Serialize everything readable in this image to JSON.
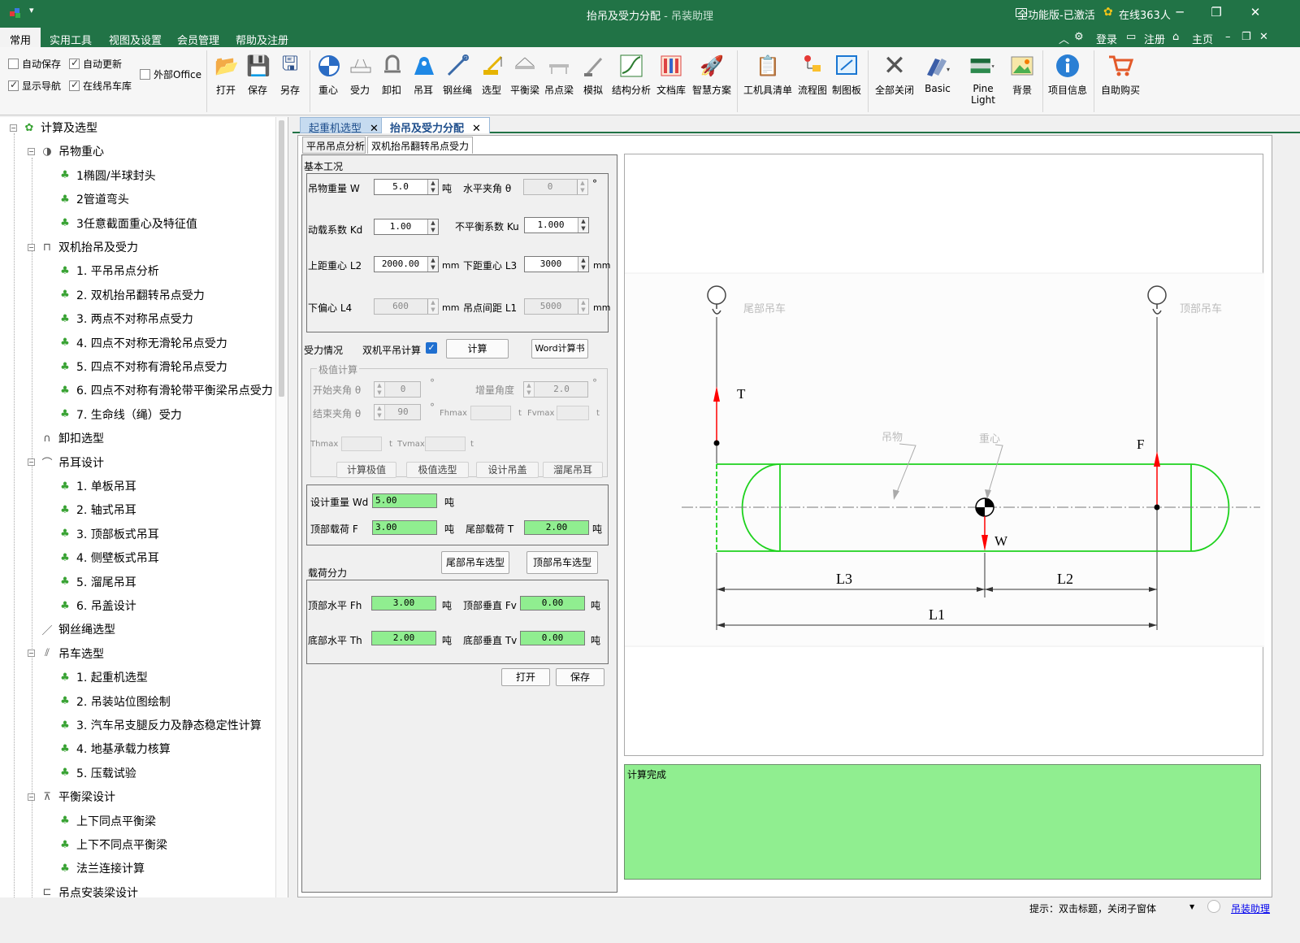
{
  "window": {
    "title": "抬吊及受力分配",
    "title_suffix": " - 吊装助理",
    "edition": "全功能版-已激活",
    "online": "在线363人"
  },
  "menu": {
    "items": [
      "常用",
      "实用工具",
      "视图及设置",
      "会员管理",
      "帮助及注册"
    ],
    "active": "常用",
    "login": "登录",
    "register": "注册",
    "home": "主页"
  },
  "ribbon": {
    "checks": [
      {
        "label": "自动保存",
        "checked": false
      },
      {
        "label": "自动更新",
        "checked": true
      },
      {
        "label": "外部Office",
        "checked": false
      },
      {
        "label": "显示导航",
        "checked": true
      },
      {
        "label": "在线吊车库",
        "checked": true
      }
    ],
    "buttons": [
      {
        "label": "打开",
        "icon": "folder-icon"
      },
      {
        "label": "保存",
        "icon": "save-icon"
      },
      {
        "label": "另存",
        "icon": "save-as-icon"
      },
      {
        "label": "重心",
        "icon": "center-gravity-icon"
      },
      {
        "label": "受力",
        "icon": "force-icon"
      },
      {
        "label": "卸扣",
        "icon": "shackle-icon"
      },
      {
        "label": "吊耳",
        "icon": "lug-icon"
      },
      {
        "label": "钢丝绳",
        "icon": "wire-rope-icon"
      },
      {
        "label": "选型",
        "icon": "crane-icon"
      },
      {
        "label": "平衡梁",
        "icon": "balance-beam-icon"
      },
      {
        "label": "吊点梁",
        "icon": "lift-beam-icon"
      },
      {
        "label": "模拟",
        "icon": "simulate-icon"
      },
      {
        "label": "结构分析",
        "icon": "analysis-icon"
      },
      {
        "label": "文档库",
        "icon": "library-icon"
      },
      {
        "label": "智慧方案",
        "icon": "smart-icon"
      },
      {
        "label": "工机具清单",
        "icon": "clipboard-icon"
      },
      {
        "label": "流程图",
        "icon": "flowchart-icon"
      },
      {
        "label": "制图板",
        "icon": "drawing-board-icon"
      },
      {
        "label": "全部关闭",
        "icon": "close-all-icon"
      },
      {
        "label": "Basic",
        "icon": "theme-basic-icon"
      },
      {
        "label": "Pine Light",
        "icon": "theme-pine-icon"
      },
      {
        "label": "背景",
        "icon": "background-icon"
      },
      {
        "label": "项目信息",
        "icon": "info-icon"
      },
      {
        "label": "自助购买",
        "icon": "cart-icon"
      }
    ]
  },
  "tree": [
    {
      "label": "计算及选型",
      "level": 0,
      "expander": "⊟"
    },
    {
      "label": "吊物重心",
      "level": 1,
      "expander": "⊟"
    },
    {
      "label": "1椭圆/半球封头",
      "level": 2
    },
    {
      "label": "2管道弯头",
      "level": 2
    },
    {
      "label": "3任意截面重心及特征值",
      "level": 2
    },
    {
      "label": "双机抬吊及受力",
      "level": 1,
      "expander": "⊟"
    },
    {
      "label": "1. 平吊吊点分析",
      "level": 2
    },
    {
      "label": "2. 双机抬吊翻转吊点受力",
      "level": 2
    },
    {
      "label": "3. 两点不对称吊点受力",
      "level": 2
    },
    {
      "label": "4. 四点不对称无滑轮吊点受力",
      "level": 2
    },
    {
      "label": "5. 四点不对称有滑轮吊点受力",
      "level": 2
    },
    {
      "label": "6. 四点不对称有滑轮带平衡梁吊点受力",
      "level": 2
    },
    {
      "label": "7. 生命线（绳）受力",
      "level": 2
    },
    {
      "label": "卸扣选型",
      "level": 1
    },
    {
      "label": "吊耳设计",
      "level": 1,
      "expander": "⊟"
    },
    {
      "label": "1. 单板吊耳",
      "level": 2
    },
    {
      "label": "2. 轴式吊耳",
      "level": 2
    },
    {
      "label": "3. 顶部板式吊耳",
      "level": 2
    },
    {
      "label": "4. 侧壁板式吊耳",
      "level": 2
    },
    {
      "label": "5. 溜尾吊耳",
      "level": 2
    },
    {
      "label": "6. 吊盖设计",
      "level": 2
    },
    {
      "label": "钢丝绳选型",
      "level": 1
    },
    {
      "label": "吊车选型",
      "level": 1,
      "expander": "⊟"
    },
    {
      "label": "1. 起重机选型",
      "level": 2
    },
    {
      "label": "2. 吊装站位图绘制",
      "level": 2
    },
    {
      "label": "3. 汽车吊支腿反力及静态稳定性计算",
      "level": 2
    },
    {
      "label": "4. 地基承载力核算",
      "level": 2
    },
    {
      "label": "5. 压载试验",
      "level": 2
    },
    {
      "label": "平衡梁设计",
      "level": 1,
      "expander": "⊟"
    },
    {
      "label": "上下同点平衡梁",
      "level": 2
    },
    {
      "label": "上下不同点平衡梁",
      "level": 2
    },
    {
      "label": "法兰连接计算",
      "level": 2
    },
    {
      "label": "吊点安装梁设计",
      "level": 1
    }
  ],
  "doc_tabs": [
    {
      "label": "起重机选型",
      "active": false
    },
    {
      "label": "抬吊及受力分配",
      "active": true
    }
  ],
  "sub_tabs": [
    {
      "label": "平吊吊点分析",
      "active": false
    },
    {
      "label": "双机抬吊翻转吊点受力",
      "active": true
    }
  ],
  "form": {
    "basic_title": "基本工况",
    "weight_label": "吊物重量 W",
    "weight": "5.0",
    "ton": "吨",
    "angle_label": "水平夹角 θ",
    "angle": "0",
    "deg": "°",
    "kd_label": "动载系数 Kd",
    "kd": "1.00",
    "ku_label": "不平衡系数 Ku",
    "ku": "1.000",
    "l2_label": "上距重心 L2",
    "l2": "2000.00",
    "mm": "mm",
    "l3_label": "下距重心 L3",
    "l3": "3000",
    "l4_label": "下偏心 L4",
    "l4": "600",
    "l1_label": "吊点间距 L1",
    "l1": "5000",
    "force_title": "受力情况",
    "dual_label": "双机平吊计算",
    "dual_checked": true,
    "calc_btn": "计算",
    "word_btn": "Word计算书",
    "extreme_title": "极值计算",
    "start_angle_label": "开始夹角 θ",
    "start_angle": "0",
    "step_label": "增量角度",
    "step": "2.0",
    "end_angle_label": "结束夹角 θ",
    "end_angle": "90",
    "fhmax_label": "Fhmax",
    "fvmax_label": "Fvmax",
    "t_unit": "t",
    "thmax_label": "Thmax",
    "tvmax_label": "Tvmax",
    "btn_calc_extreme": "计算极值",
    "btn_extreme_select": "极值选型",
    "btn_design_cover": "设计吊盖",
    "btn_tail_lug": "溜尾吊耳",
    "design_weight_label": "设计重量 Wd",
    "design_weight": "5.00",
    "top_load_label": "顶部载荷 F",
    "top_load": "3.00",
    "tail_load_label": "尾部载荷 T",
    "tail_load": "2.00",
    "tail_crane_btn": "尾部吊车选型",
    "top_crane_btn": "顶部吊车选型",
    "split_title": "载荷分力",
    "fh_label": "顶部水平 Fh",
    "fh": "3.00",
    "fv_label": "顶部垂直 Fv",
    "fv": "0.00",
    "th_label": "底部水平 Th",
    "th": "2.00",
    "tv_label": "底部垂直 Tv",
    "tv": "0.00",
    "open_btn": "打开",
    "save_btn": "保存"
  },
  "diagram": {
    "tail_crane": "尾部吊车",
    "top_crane": "顶部吊车",
    "t": "T",
    "f": "F",
    "w": "W",
    "load": "吊物",
    "cog": "重心",
    "l1": "L1",
    "l2": "L2",
    "l3": "L3",
    "line_color": "#1ed21e",
    "force_color": "#ff0000"
  },
  "status": {
    "log": "计算完成",
    "hint": "提示：双击标题，关闭子窗体",
    "link": "吊装助理"
  }
}
